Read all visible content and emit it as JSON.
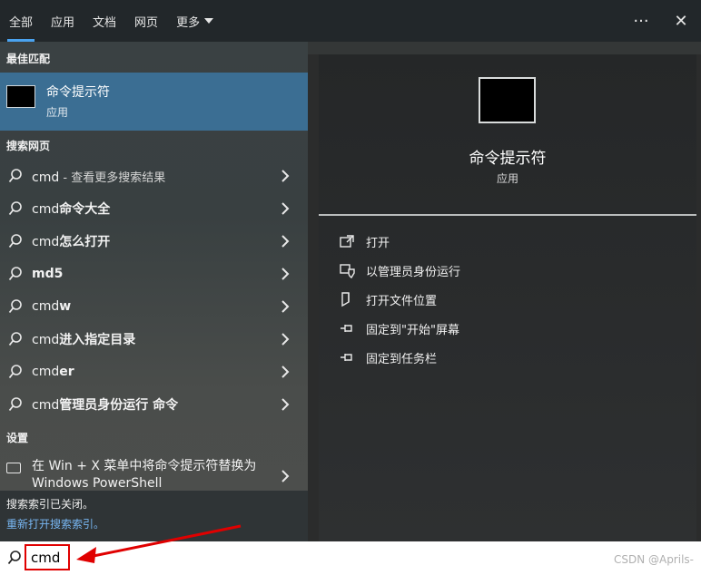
{
  "tabs": [
    {
      "label": "全部",
      "active": true
    },
    {
      "label": "应用"
    },
    {
      "label": "文档"
    },
    {
      "label": "网页"
    },
    {
      "label": "更多"
    }
  ],
  "topbar": {
    "more_icon": "ellipsis-icon",
    "close_icon": "close-icon",
    "more_glyph": "···",
    "close_glyph": "✕"
  },
  "left": {
    "best_match_title": "最佳匹配",
    "best_match": {
      "name": "命令提示符",
      "type": "应用",
      "icon": "terminal-icon"
    },
    "web_title": "搜索网页",
    "web_results": [
      {
        "query": "cmd",
        "suffix": " - 查看更多搜索结果"
      },
      {
        "query": "cmd",
        "suffix_bold": "命令大全"
      },
      {
        "query": "cmd",
        "suffix_bold": "怎么打开"
      },
      {
        "query": "md5",
        "all_bold": true
      },
      {
        "query": "cmd",
        "suffix_bold": "w"
      },
      {
        "query": "cmd",
        "suffix_bold": "进入指定目录"
      },
      {
        "query": "cmd",
        "suffix_bold": "er"
      },
      {
        "query": "cmd",
        "suffix_bold": "管理员身份运行 命令"
      }
    ],
    "settings_title": "设置",
    "setting_item": "在 Win + X 菜单中将命令提示符替换为 Windows PowerShell",
    "notice_line1": "搜索索引已关闭。",
    "notice_line2": "重新打开搜索索引。"
  },
  "preview": {
    "name": "命令提示符",
    "type": "应用",
    "actions": [
      {
        "label": "打开",
        "icon": "open-icon"
      },
      {
        "label": "以管理员身份运行",
        "icon": "shield-icon"
      },
      {
        "label": "打开文件位置",
        "icon": "file-location-icon"
      },
      {
        "label": "固定到\"开始\"屏幕",
        "icon": "pin-icon"
      },
      {
        "label": "固定到任务栏",
        "icon": "pin-icon"
      }
    ]
  },
  "search": {
    "value": "cmd",
    "icon": "search-icon"
  },
  "watermark": "CSDN @Aprils-",
  "colors": {
    "accent": "#4aa3f0",
    "selection": "#3b6e93",
    "highlight_box": "#e00000"
  }
}
